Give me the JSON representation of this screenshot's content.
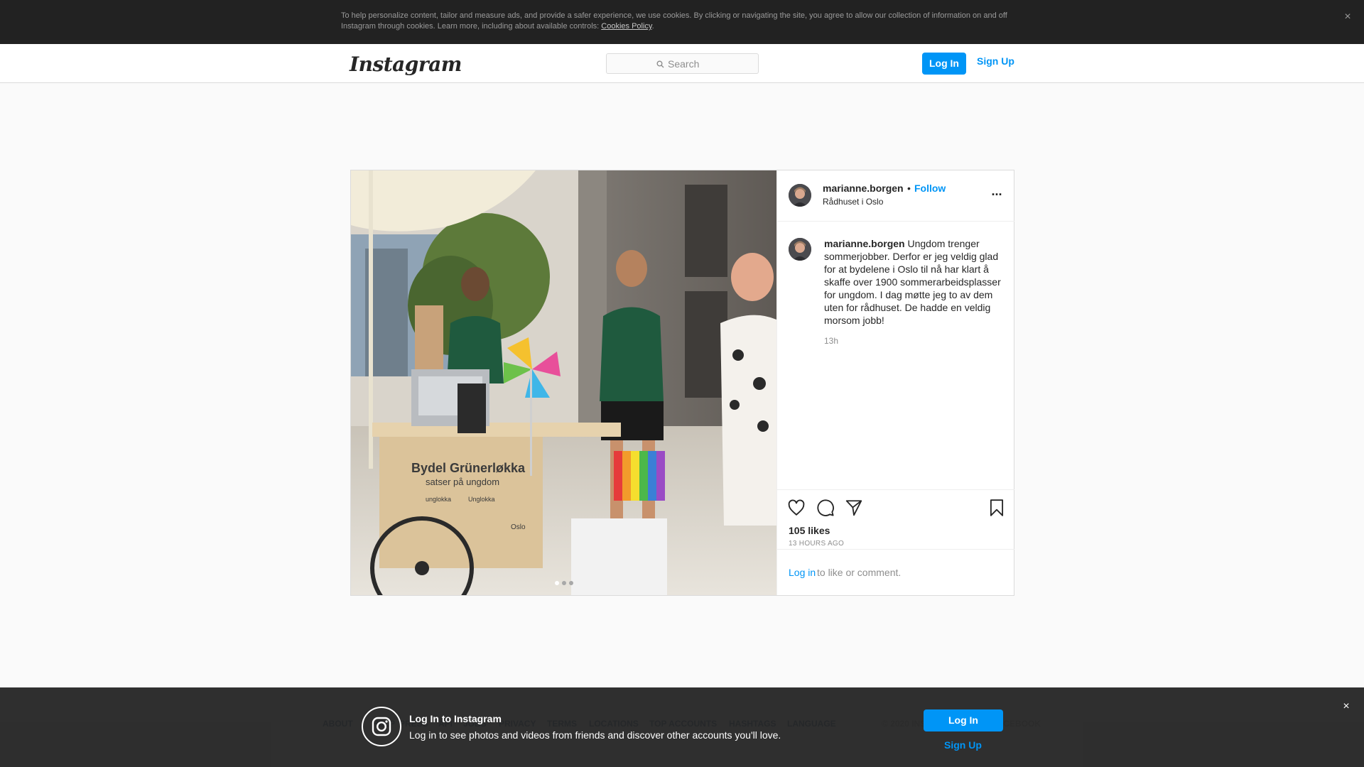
{
  "cookie_banner": {
    "text": "To help personalize content, tailor and measure ads, and provide a safer experience, we use cookies. By clicking or navigating the site, you agree to allow our collection of information on and off Instagram through cookies. Learn more, including about available controls: ",
    "link": "Cookies Policy",
    "end": ".",
    "close": "×"
  },
  "nav": {
    "logo": "Instagram",
    "search_placeholder": "Search",
    "login": "Log In",
    "signup": "Sign Up"
  },
  "post": {
    "username": "marianne.borgen",
    "bullet": "•",
    "follow": "Follow",
    "location": "Rådhuset i Oslo",
    "more": "...",
    "caption_user": "marianne.borgen",
    "caption_text": "Ungdom trenger sommerjobber. Derfor er jeg veldig glad for at bydelene i Oslo til nå har klart å skaffe over 1900 sommerarbeidsplasser for ungdom. I dag møtte jeg to av dem uten for rådhuset. De hadde en veldig morsom jobb!",
    "caption_time": "13h",
    "likes": "105 likes",
    "time_ago": "13 HOURS AGO",
    "login_link": "Log in",
    "login_rest": "to like or comment.",
    "carousel_count": 3,
    "carousel_active": 1,
    "photo_sign_title": "Bydel Grünerløkka",
    "photo_sign_sub": "satser på ungdom",
    "photo_sign_ig": "unglokka",
    "photo_sign_fb": "Unglokka",
    "photo_sign_oslo": "Oslo"
  },
  "footer": {
    "links": [
      "ABOUT",
      "HELP",
      "PRESS",
      "API",
      "JOBS",
      "PRIVACY",
      "TERMS",
      "LOCATIONS",
      "TOP ACCOUNTS",
      "HASHTAGS",
      "LANGUAGE"
    ],
    "copyright": "© 2020 INSTAGRAM FROM FACEBOOK"
  },
  "login_bar": {
    "title": "Log In to Instagram",
    "subtitle": "Log in to see photos and videos from friends and discover other accounts you'll love.",
    "login": "Log In",
    "signup": "Sign Up",
    "close": "×"
  },
  "colors": {
    "accent": "#0095f6",
    "cookie_bg": "#222222",
    "login_bar_bg": "#262626"
  }
}
